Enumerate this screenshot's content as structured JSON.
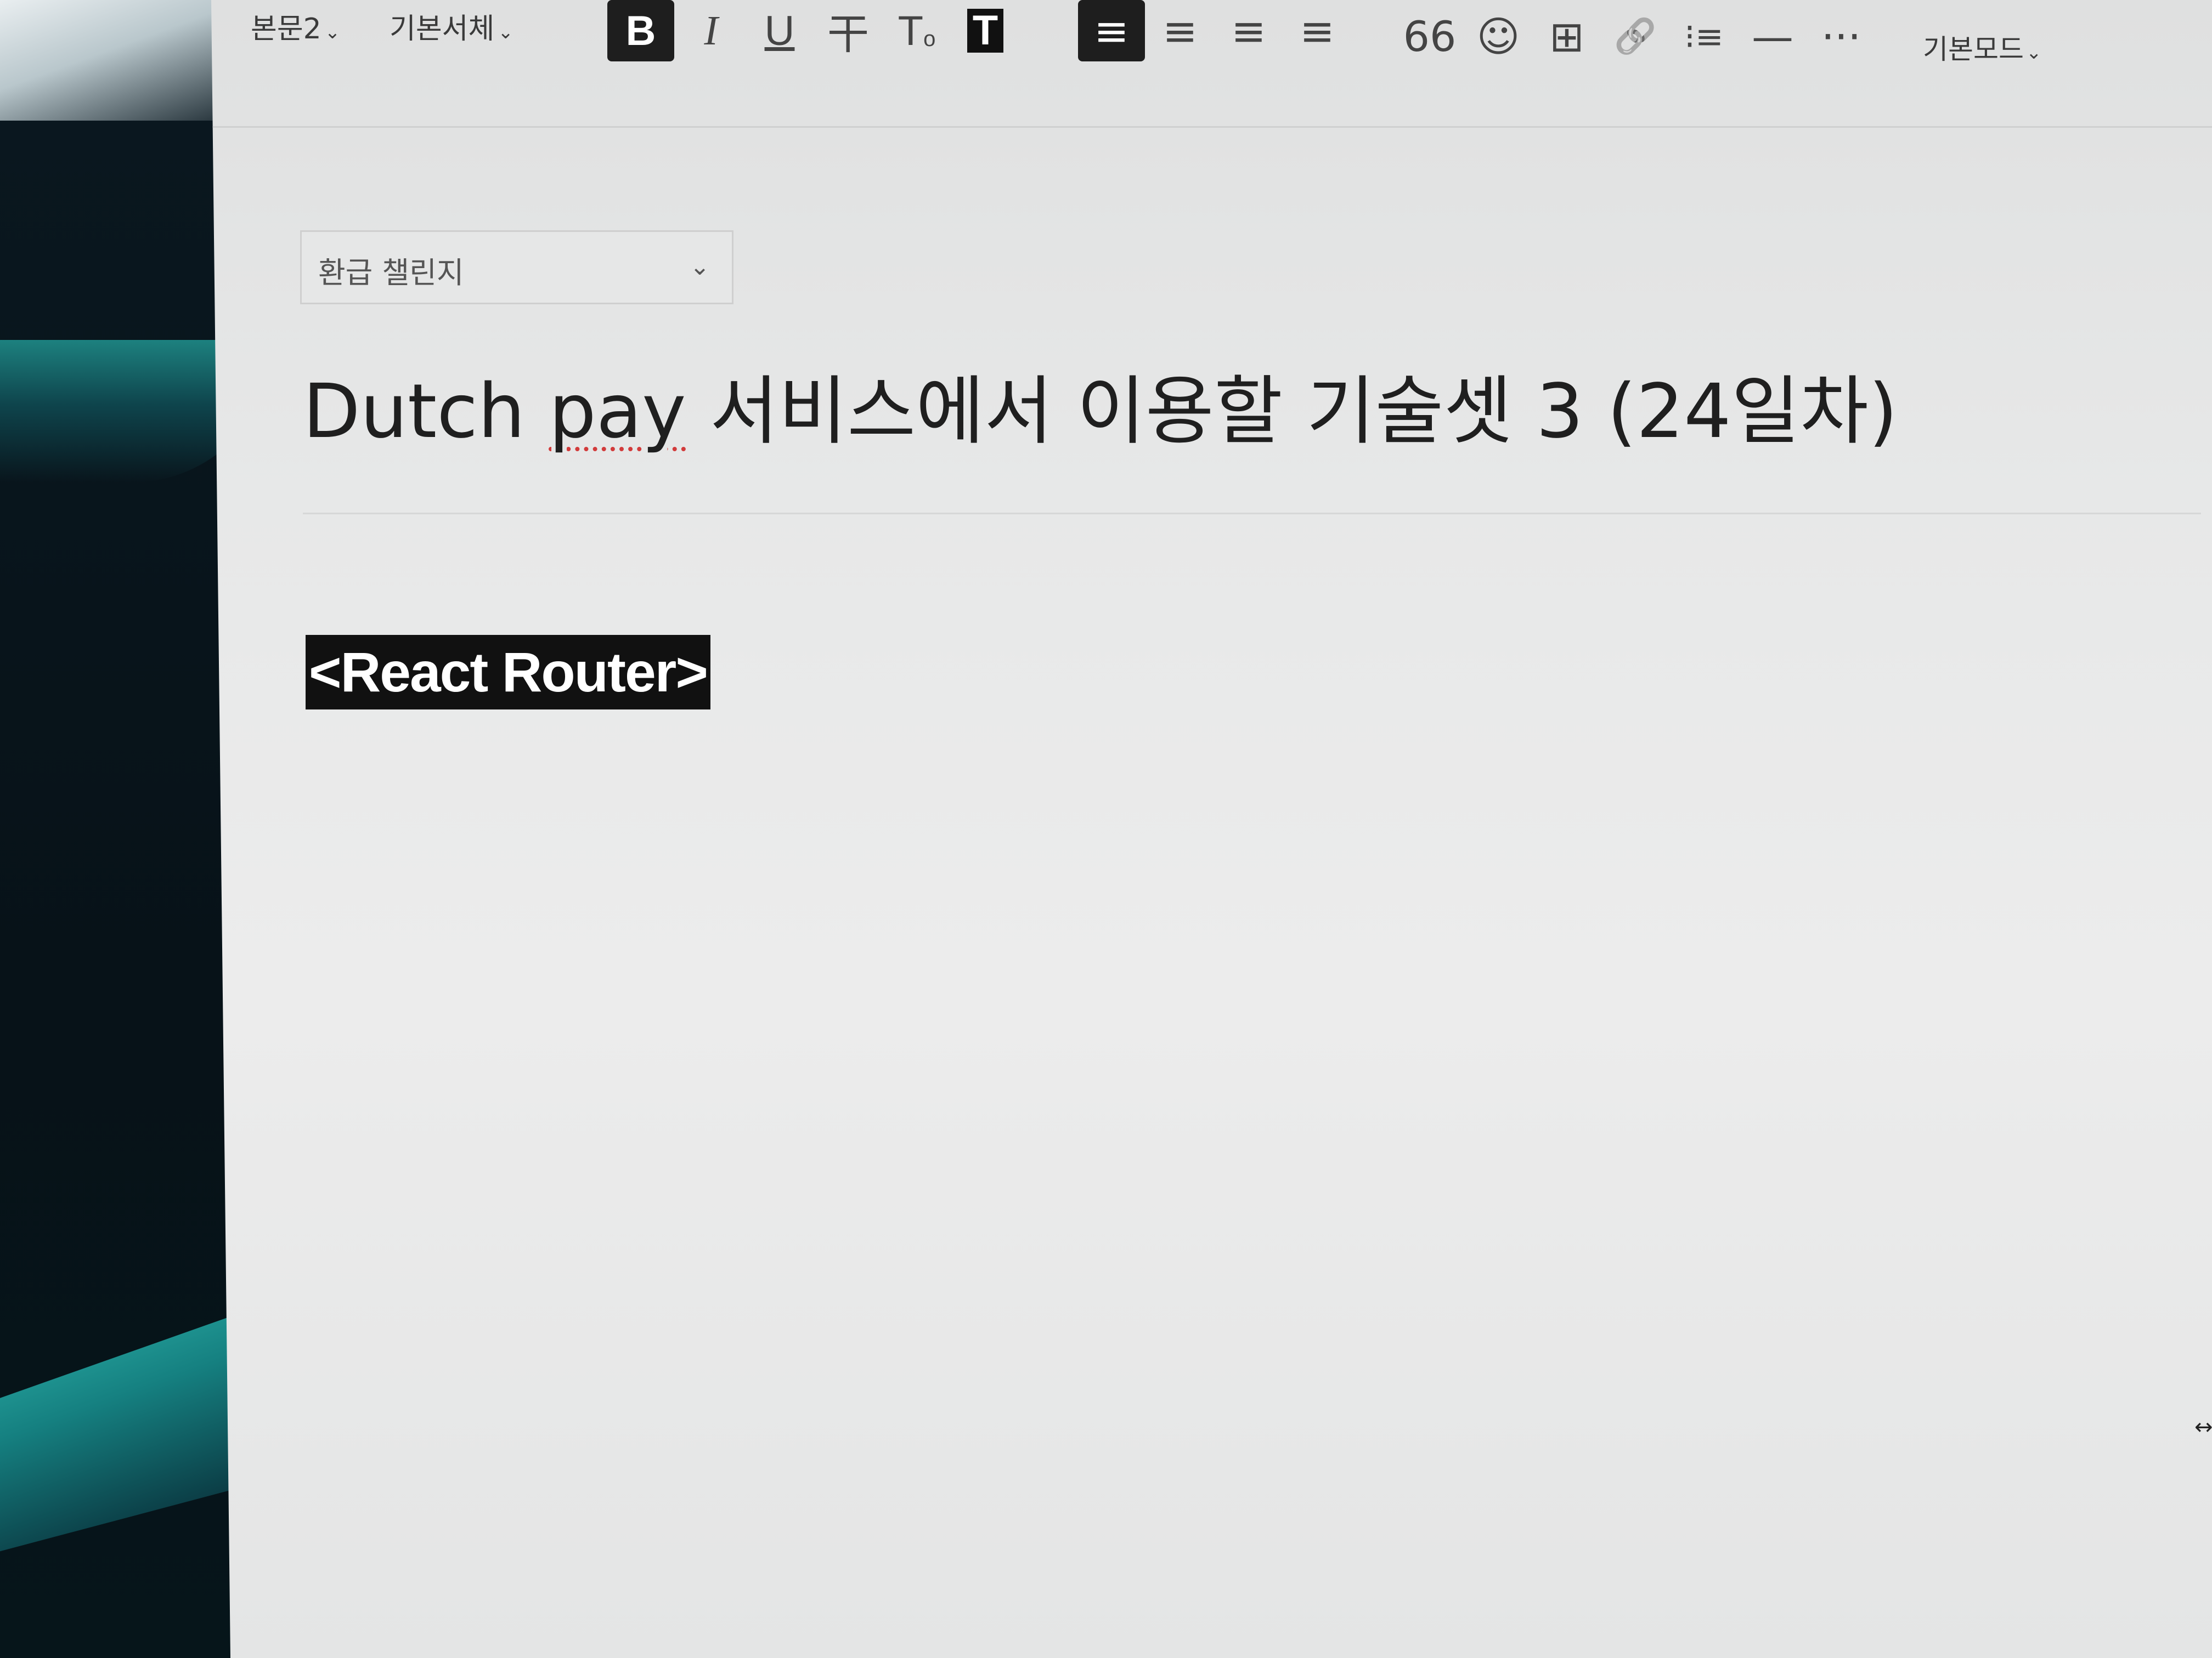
{
  "toolbar": {
    "paragraph_style": "본문2",
    "font_family": "기본서체",
    "bold": "B",
    "italic": "I",
    "underline": "U",
    "strikethrough": "干",
    "text_color": "T",
    "text_color_sub": "o",
    "text_bg": "T",
    "align_left": "≡",
    "align_center": "≡",
    "align_right": "≡",
    "align_justify": "≡",
    "quote": "66",
    "emoji": "☺",
    "table": "⊞",
    "link": "🔗",
    "list": "⁝≡",
    "divider": "—",
    "more": "···",
    "mode": "기본모드"
  },
  "category": {
    "selected": "환급 챌린지"
  },
  "post": {
    "title_pre": "Dutch ",
    "title_misspelled": "pay",
    "title_post": " 서비스에서 이용할 기술셋 3 (24일차)",
    "heading": "<React Router>"
  }
}
